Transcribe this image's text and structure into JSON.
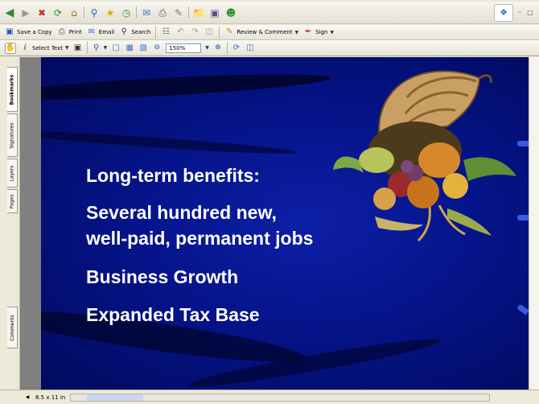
{
  "toolbar": {
    "save_copy_label": "Save a Copy",
    "print_label": "Print",
    "email_label": "Email",
    "search_label": "Search",
    "review_comment_label": "Review & Comment",
    "sign_label": "Sign"
  },
  "tools": {
    "select_text_label": "Select Text",
    "zoom_value": "150%"
  },
  "side_tabs": [
    "Bookmarks",
    "Signatures",
    "Layers",
    "Pages",
    "Comments"
  ],
  "slide": {
    "heading": "Long-term benefits:",
    "line1": "Several hundred new,",
    "line2": "well-paid, permanent jobs",
    "line3": "Business Growth",
    "line4": "Expanded Tax Base"
  },
  "status": {
    "page_size": "8.5 x 11 in"
  },
  "colors": {
    "slide_background": "#05148a",
    "slide_text": "#ffffff",
    "chrome": "#ece9d8"
  }
}
